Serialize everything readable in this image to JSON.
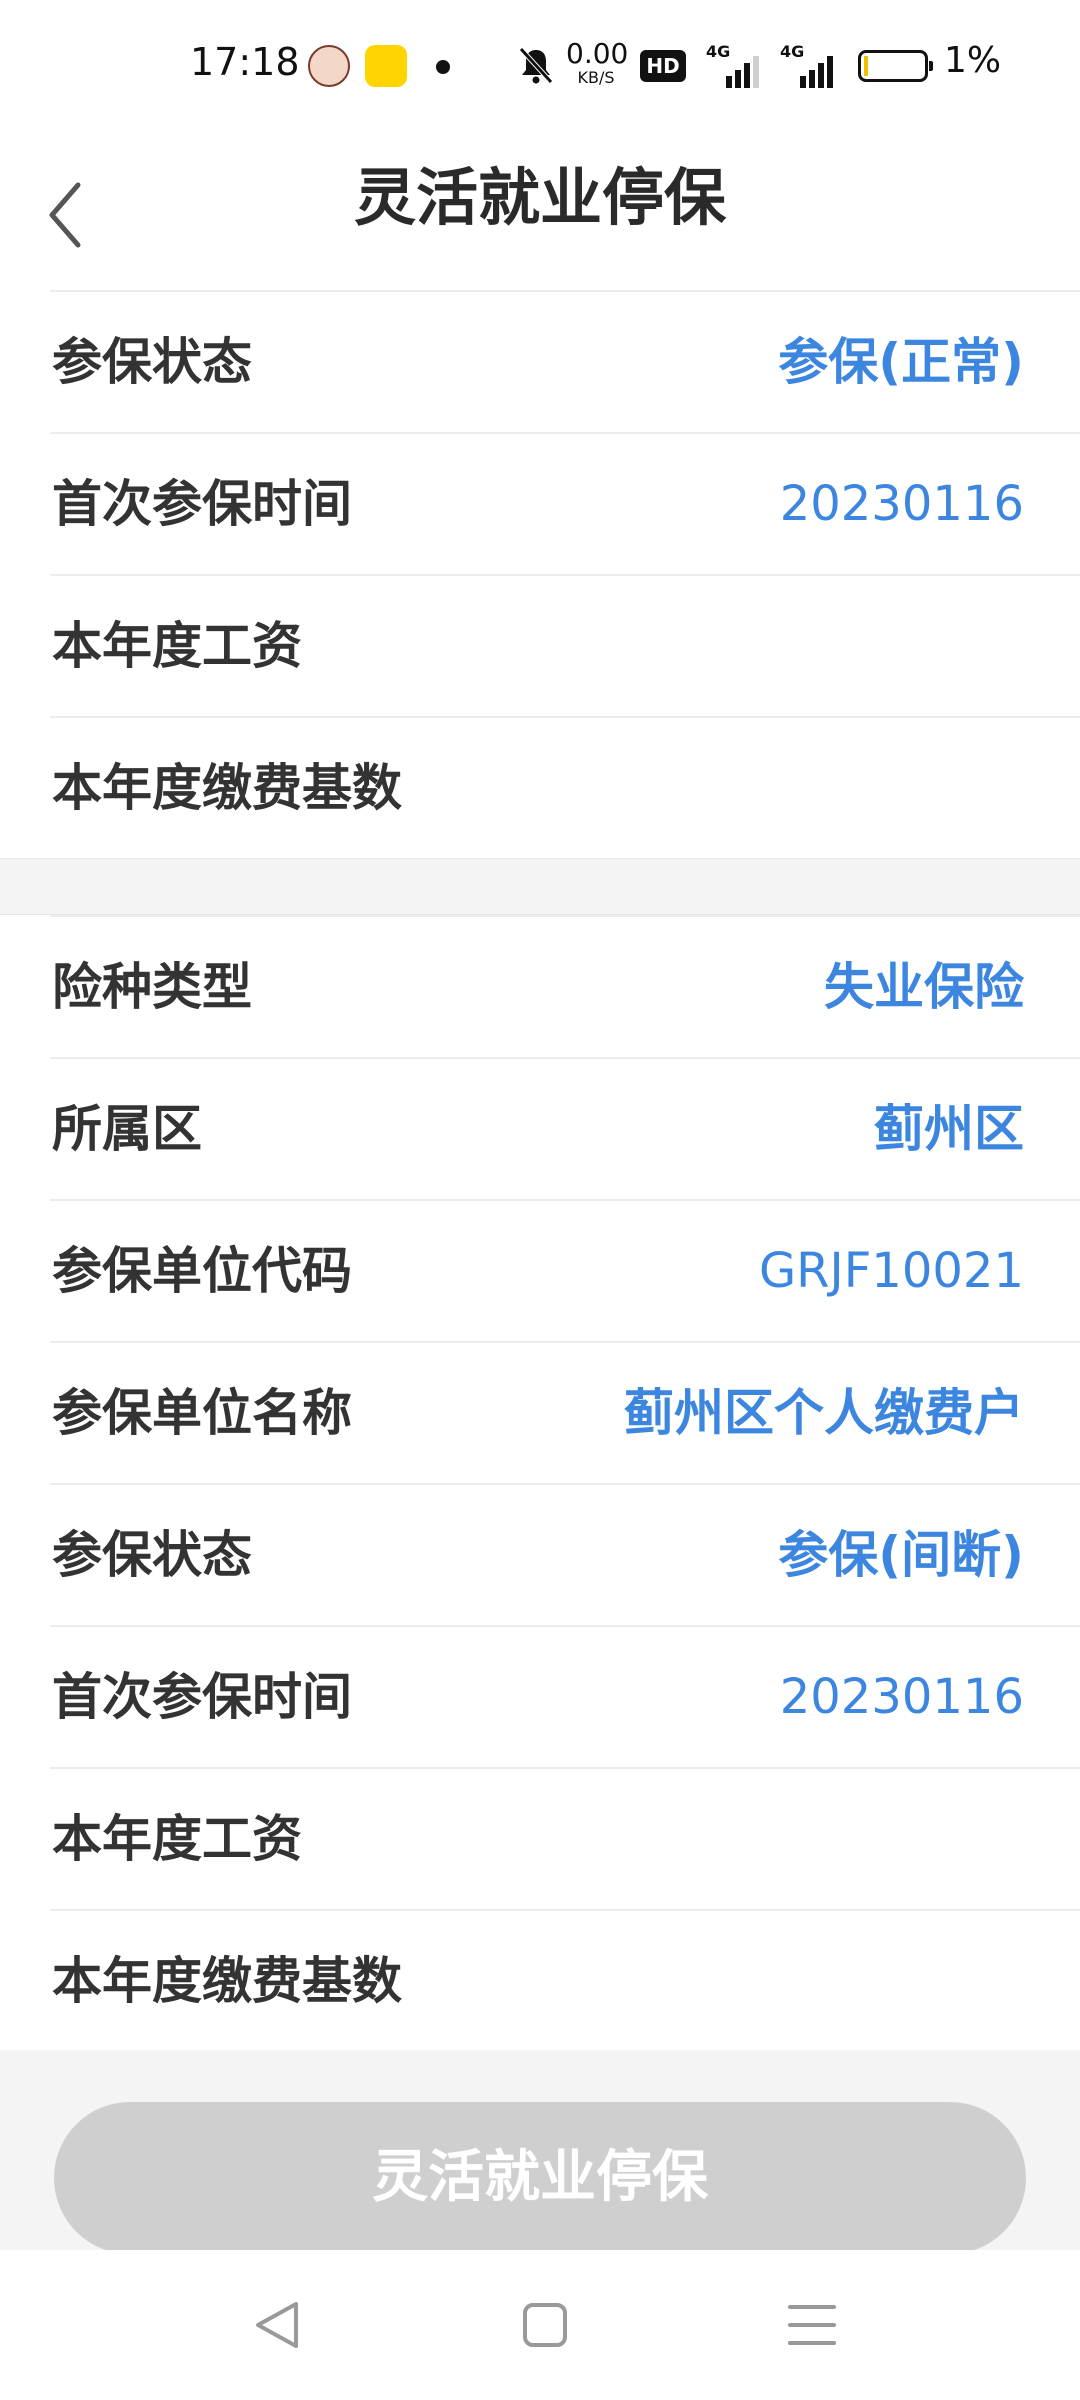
{
  "status_bar": {
    "time": "17:18",
    "net_speed_value": "0.00",
    "net_speed_unit": "KB/S",
    "hd_label": "HD",
    "sim1_tag": "4G",
    "sim2_tag": "4G",
    "battery_percent": "1%",
    "battery_level": 0.01,
    "icons": [
      "avatar-app-icon",
      "yellow-app-icon",
      "notification-dot-icon",
      "mute-icon",
      "hd-icon",
      "signal-icon",
      "signal-icon",
      "battery-icon"
    ]
  },
  "header": {
    "title": "灵活就业停保",
    "back_icon": "chevron-left-icon"
  },
  "section1": {
    "rows": [
      {
        "label": "参保状态",
        "value": "参保(正常)"
      },
      {
        "label": "首次参保时间",
        "value": "20230116"
      },
      {
        "label": "本年度工资",
        "value": ""
      },
      {
        "label": "本年度缴费基数",
        "value": ""
      }
    ]
  },
  "section2": {
    "rows": [
      {
        "label": "险种类型",
        "value": "失业保险"
      },
      {
        "label": "所属区",
        "value": "蓟州区"
      },
      {
        "label": "参保单位代码",
        "value": "GRJF10021"
      },
      {
        "label": "参保单位名称",
        "value": "蓟州区个人缴费户"
      },
      {
        "label": "参保状态",
        "value": "参保(间断)"
      },
      {
        "label": "首次参保时间",
        "value": "20230116"
      },
      {
        "label": "本年度工资",
        "value": ""
      },
      {
        "label": "本年度缴费基数",
        "value": ""
      }
    ]
  },
  "action": {
    "button_label": "灵活就业停保"
  },
  "colors": {
    "value_blue": "#3d86e0",
    "button_disabled": "#cfcfcf",
    "section_gap": "#f4f4f4"
  },
  "nav_bar": {
    "icons": [
      "nav-back-icon",
      "nav-home-icon",
      "nav-menu-icon"
    ]
  }
}
